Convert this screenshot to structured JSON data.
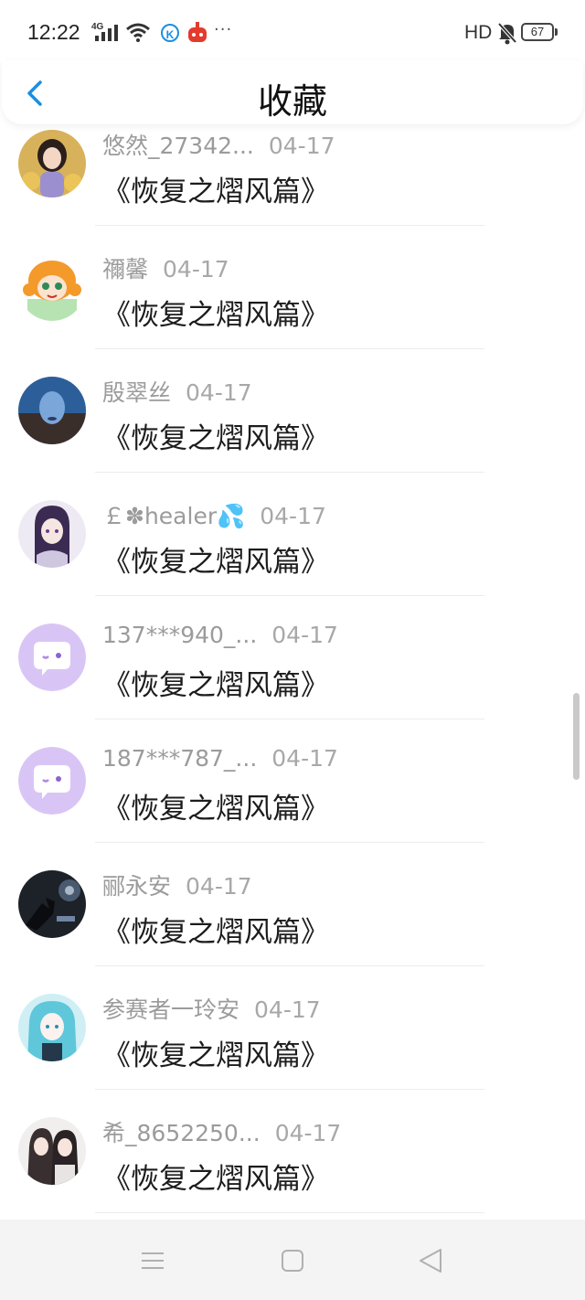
{
  "status_bar": {
    "time": "12:22",
    "network": "4G",
    "hd": "HD",
    "battery": "67"
  },
  "header": {
    "title": "收藏",
    "back_icon": "chevron-left-icon"
  },
  "items": [
    {
      "user": "悠然_27342...",
      "date": "04-17",
      "title": "《恢复之熠风篇》",
      "avatar": "photo-girl-flowers"
    },
    {
      "user": "禰馨",
      "date": "04-17",
      "title": "《恢复之熠风篇》",
      "avatar": "cartoon-orange-hair"
    },
    {
      "user": "殷翠丝",
      "date": "04-17",
      "title": "《恢复之熠风篇》",
      "avatar": "photo-blue-face"
    },
    {
      "user": "￡✽healer💦",
      "date": "04-17",
      "title": "《恢复之熠风篇》",
      "avatar": "anime-girl-purple"
    },
    {
      "user": "137***940_...",
      "date": "04-17",
      "title": "《恢复之熠风篇》",
      "avatar": "default-chat-bubble"
    },
    {
      "user": "187***787_...",
      "date": "04-17",
      "title": "《恢复之熠风篇》",
      "avatar": "default-chat-bubble"
    },
    {
      "user": "郦永安",
      "date": "04-17",
      "title": "《恢复之熠风篇》",
      "avatar": "dark-hand-photo"
    },
    {
      "user": "参赛者一玲安",
      "date": "04-17",
      "title": "《恢复之熠风篇》",
      "avatar": "anime-cyan-hair"
    },
    {
      "user": "希_8652250...",
      "date": "04-17",
      "title": "《恢复之熠风篇》",
      "avatar": "anime-two-girls"
    }
  ],
  "colors": {
    "accent": "#1a8fe3",
    "default_avatar_bg": "#d9c5f5",
    "meta_text": "#9b9b9b",
    "title_text": "#1c1c1c"
  },
  "nav_bar": {
    "menu_icon": "menu-icon",
    "home_icon": "home-square-icon",
    "back_icon": "back-triangle-icon"
  }
}
